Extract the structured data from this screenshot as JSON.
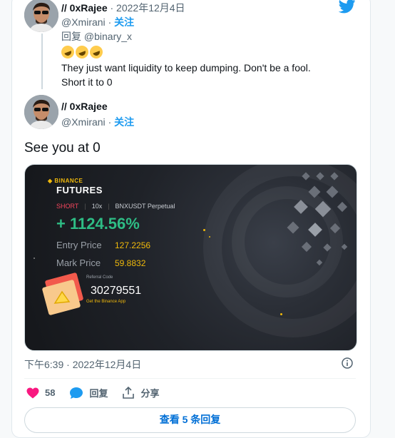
{
  "quoted": {
    "display_name": "// 0xRajee",
    "date": "· 2022年12月4日",
    "handle": "@Xmirani",
    "dot": "·",
    "follow": "关注",
    "reply_to": "回复 @binary_x",
    "emoji": "rolling-on-floor-laughing x3",
    "text_line1": "They just want liquidity to keep dumping. Don't be a fool.",
    "text_line2": "Short it to 0"
  },
  "main": {
    "display_name": "// 0xRajee",
    "handle": "@Xmirani",
    "dot": "·",
    "follow": "关注",
    "text": "See you at 0"
  },
  "media": {
    "brand": "BINANCE",
    "product": "FUTURES",
    "side": "SHORT",
    "leverage": "10x",
    "symbol": "BNXUSDT Perpetual",
    "pnl": "+ 1124.56%",
    "entry_label": "Entry Price",
    "entry_value": "127.2256",
    "mark_label": "Mark Price",
    "mark_value": "59.8832",
    "ref_label": "Referral Code",
    "ref_code": "30279551",
    "ref_app": "Get the Binance App"
  },
  "timestamp": "下午6:39 · 2022年12月4日",
  "actions": {
    "likes": "58",
    "reply": "回复",
    "share": "分享"
  },
  "more_replies": "查看 5 条回复",
  "colors": {
    "accent": "#1d9bf0",
    "like": "#f91880",
    "profit": "#2ebd85",
    "binance_yellow": "#f0b90b"
  }
}
